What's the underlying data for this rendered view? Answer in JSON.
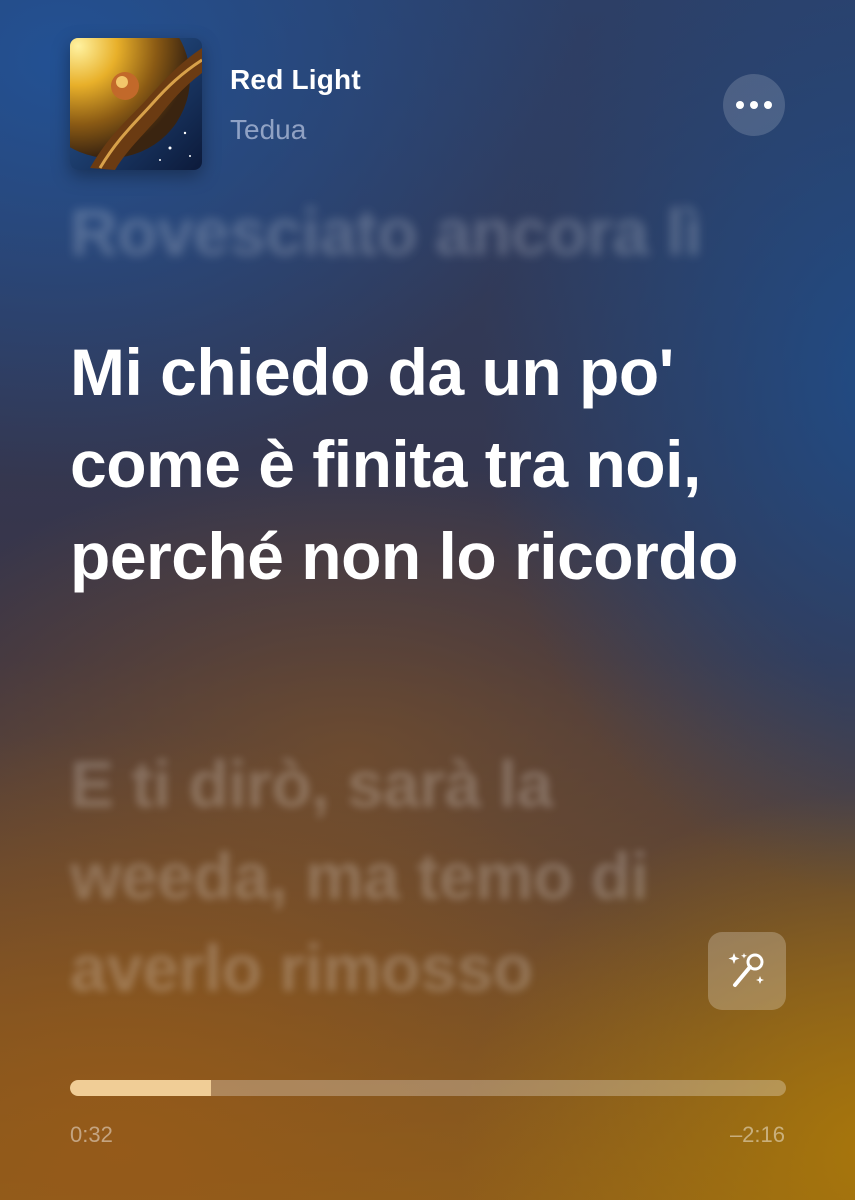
{
  "track": {
    "title": "Red Light",
    "artist": "Tedua"
  },
  "lyrics": {
    "previous": "Rovesciato ancora lì",
    "current": "Mi chiedo da un po' come è finita tra noi, perché non lo ricordo",
    "next": "E ti dirò, sarà la weeda, ma temo di averlo rimosso"
  },
  "playback": {
    "elapsed": "0:32",
    "remaining": "–2:16",
    "progress_fraction": 0.197
  },
  "icons": {
    "more": "ellipsis-icon",
    "lyrics_mode": "sing-microphone-icon",
    "cover": "album-cover"
  },
  "colors": {
    "accent_progress": "#f0cd96"
  }
}
